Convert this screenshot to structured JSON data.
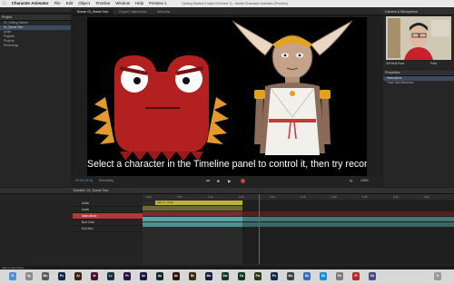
{
  "menubar": {
    "app": "Character Animator",
    "items": [
      "File",
      "Edit",
      "Object",
      "Timeline",
      "Window",
      "Help",
      "Preview 1"
    ],
    "window_title": "Getting Started Project (Preview 1) - Adobe Character Animator (Preview)"
  },
  "project": {
    "title": "Project",
    "items": [
      "00_Getting Started",
      "01_Scene Tour",
      "Audio",
      "Puppets",
      "Projects",
      "Recordings"
    ]
  },
  "scene_tabs": [
    "Scene: 01_Scene Tour",
    "Puppet: Instructions",
    "Welcome"
  ],
  "stage": {
    "caption": "Select a character in the Timeline panel to control it, then try recording",
    "time": "00:00:14:18",
    "recording_label": "Recording",
    "zoom": "100%"
  },
  "camera": {
    "title": "Camera & Microphone",
    "set_rest_pose": "Set Rest Pose",
    "pose_label": "Pose"
  },
  "properties": {
    "title": "Properties",
    "rows": [
      "Instructions",
      "Track Visit Behaviors"
    ]
  },
  "timeline": {
    "title": "Timeline: 01_Scene Tour",
    "tracks": [
      "Audio",
      "Audio",
      "Instructions",
      "Burt Crab",
      "Kid Hero"
    ],
    "clip_label": "Intro 1 - Crab",
    "ruler": [
      "0:00",
      "0:05",
      "0:10",
      "0:15",
      "0:20",
      "0:25",
      "0:30",
      "0:35",
      "0:40",
      "0:45"
    ]
  },
  "status": {
    "text": "Add to New Scene"
  },
  "dock": {
    "icons": [
      "Fi",
      "Sy",
      "Mu",
      "Ps",
      "Ai",
      "Id",
      "Lr",
      "Pr",
      "Ae",
      "Au",
      "An",
      "Br",
      "Me",
      "Dw",
      "Ca",
      "Fw",
      "Ps",
      "Mu",
      "Sa",
      "Sk",
      "Pd",
      "Fl",
      "Ch",
      "Tr"
    ]
  },
  "colors": {
    "instructions_track": "#b03a3a",
    "crab_track": "#5aa7a7",
    "kid_track": "#4d8f8f",
    "clip": "#bfb23b",
    "accent_blue": "#2f74c0"
  }
}
